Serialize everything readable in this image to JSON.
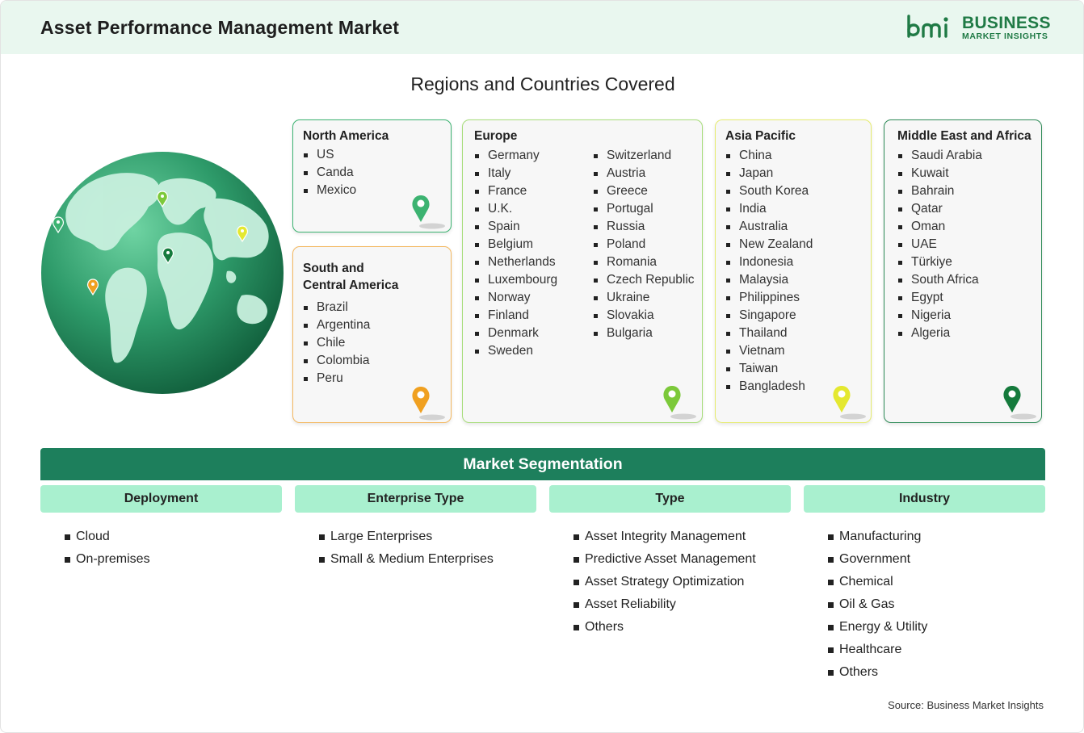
{
  "header": {
    "title": "Asset Performance Management Market",
    "logo_word1": "BUSINESS",
    "logo_word2": "MARKET INSIGHTS",
    "logo_mark_text": "bmi"
  },
  "section_title": "Regions and Countries Covered",
  "regions": [
    {
      "title": "North America",
      "color": "#3cb371",
      "pin_color": "#3cb371",
      "countries": [
        "US",
        "Canda",
        "Mexico"
      ]
    },
    {
      "title": "South and Central America",
      "title_line1": "South and",
      "title_line2": "Central America",
      "color": "#f4b860",
      "pin_color": "#f0a020",
      "countries": [
        "Brazil",
        "Argentina",
        "Chile",
        "Colombia",
        "Peru"
      ]
    },
    {
      "title": "Europe",
      "color": "#a7dd7a",
      "pin_color": "#7cc93a",
      "countries_col1": [
        "Germany",
        "Italy",
        "France",
        "U.K.",
        "Spain",
        "Belgium",
        "Netherlands",
        "Luxembourg",
        "Norway",
        "Finland",
        "Denmark",
        "Sweden"
      ],
      "countries_col2": [
        "Switzerland",
        "Austria",
        "Greece",
        "Portugal",
        "Russia",
        "Poland",
        "Romania",
        "Czech Republic",
        "Ukraine",
        "Slovakia",
        "Bulgaria"
      ]
    },
    {
      "title": "Asia Pacific",
      "color": "#e6ec6e",
      "pin_color": "#e4e830",
      "countries": [
        "China",
        "Japan",
        "South Korea",
        "India",
        "Australia",
        "New Zealand",
        "Indonesia",
        "Malaysia",
        "Philippines",
        "Singapore",
        "Thailand",
        "Vietnam",
        "Taiwan",
        "Bangladesh"
      ]
    },
    {
      "title": "Middle East and Africa",
      "color": "#2e8b57",
      "pin_color": "#157a3c",
      "countries": [
        "Saudi Arabia",
        "Kuwait",
        "Bahrain",
        "Qatar",
        "Oman",
        "UAE",
        "Türkiye",
        "South Africa",
        "Egypt",
        "Nigeria",
        "Algeria"
      ]
    }
  ],
  "segmentation": {
    "title": "Market Segmentation",
    "columns": [
      {
        "heading": "Deployment",
        "items": [
          "Cloud",
          "On-premises"
        ]
      },
      {
        "heading": "Enterprise Type",
        "items": [
          "Large Enterprises",
          "Small & Medium Enterprises"
        ]
      },
      {
        "heading": "Type",
        "items": [
          "Asset Integrity Management",
          "Predictive Asset Management",
          "Asset Strategy Optimization",
          "Asset Reliability",
          "Others"
        ]
      },
      {
        "heading": "Industry",
        "items": [
          "Manufacturing",
          "Government",
          "Chemical",
          "Oil & Gas",
          "Energy & Utility",
          "Healthcare",
          "Others"
        ]
      }
    ]
  },
  "source": "Source: Business Market Insights",
  "colors": {
    "accent": "#1d7f5c",
    "header_bg": "#e9f7ef",
    "segment_head_bg": "#a9f0cf",
    "globe": "#2e9b6a"
  }
}
